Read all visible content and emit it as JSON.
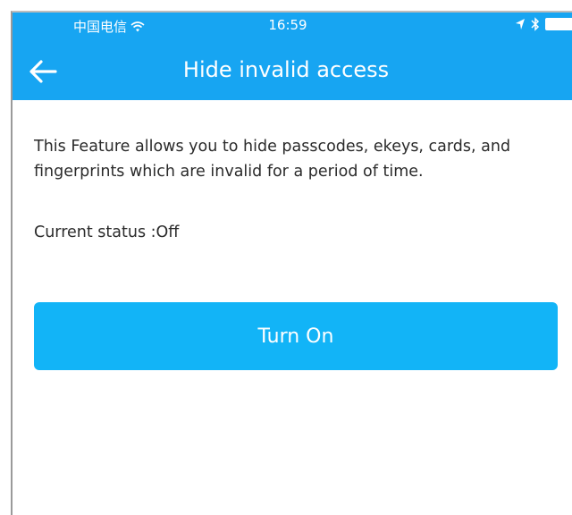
{
  "status_bar": {
    "carrier": "中国电信",
    "time": "16:59",
    "icons": [
      "wifi-icon",
      "location-arrow-icon",
      "bluetooth-icon",
      "battery-icon"
    ]
  },
  "nav": {
    "back_icon": "back-arrow-icon",
    "title": "Hide invalid access"
  },
  "content": {
    "description": "This Feature allows you to hide passcodes, ekeys, cards, and fingerprints which are invalid for a period of time.",
    "current_status": "Current status :Off"
  },
  "actions": {
    "turn_on_label": "Turn On"
  },
  "colors": {
    "header_blue": "#17a5f2",
    "button_blue": "#12b4f7",
    "text": "#2b2b2b"
  }
}
